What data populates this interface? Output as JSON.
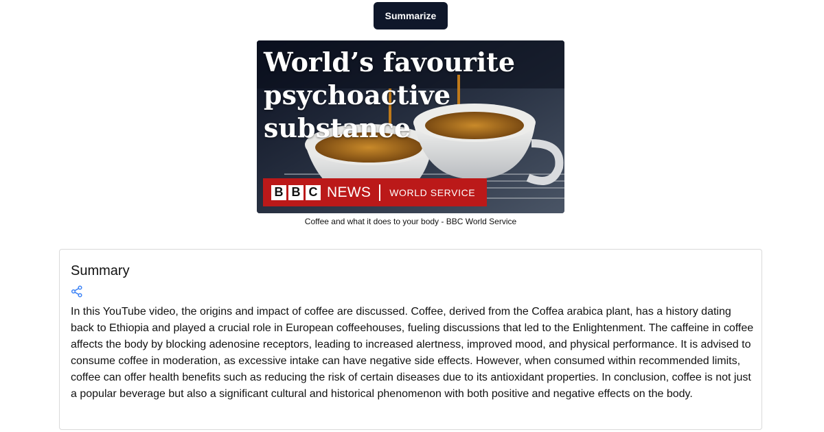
{
  "toolbar": {
    "summarize_label": "Summarize"
  },
  "video": {
    "thumbnail_headline": "World’s favourite psychoactive substance",
    "brand": {
      "block_letters": [
        "B",
        "B",
        "C"
      ],
      "news": "NEWS",
      "service": "WORLD SERVICE"
    },
    "caption": "Coffee and what it does to your body - BBC World Service"
  },
  "summary": {
    "title": "Summary",
    "share_icon": "share-icon",
    "text": "In this YouTube video, the origins and impact of coffee are discussed. Coffee, derived from the Coffea arabica plant, has a history dating back to Ethiopia and played a crucial role in European coffeehouses, fueling discussions that led to the Enlightenment. The caffeine in coffee affects the body by blocking adenosine receptors, leading to increased alertness, improved mood, and physical performance. It is advised to consume coffee in moderation, as excessive intake can have negative side effects. However, when consumed within recommended limits, coffee can offer health benefits such as reducing the risk of certain diseases due to its antioxidant properties. In conclusion, coffee is not just a popular beverage but also a significant cultural and historical phenomenon with both positive and negative effects on the body."
  },
  "colors": {
    "button_bg": "#0f172a",
    "bbc_red": "#bb1919",
    "accent_blue": "#3b82f6"
  }
}
